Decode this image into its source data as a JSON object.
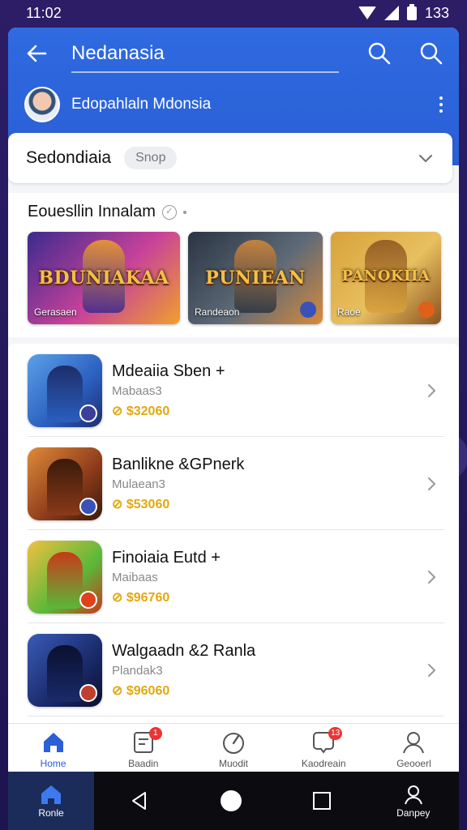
{
  "status_bar": {
    "time": "11:02",
    "battery": "133"
  },
  "header": {
    "title": "Nedanasia",
    "profile_name": "Edopahlaln Mdonsia"
  },
  "section": {
    "title": "Sedondiaia",
    "chip": "Snop"
  },
  "featured": {
    "title": "Eouesllin Innalam",
    "banners": [
      {
        "title": "BDUNIAKAA",
        "subtitle": "Gerasaen",
        "colors": [
          "#3b2a8f",
          "#c8429a",
          "#f0a02a"
        ]
      },
      {
        "title": "PUNIEAN",
        "subtitle": "Randeaon",
        "colors": [
          "#2a3442",
          "#5e6a78",
          "#d88a3a"
        ]
      },
      {
        "title": "PANOKIIA",
        "subtitle": "Raoe",
        "colors": [
          "#d8a23a",
          "#e8c060",
          "#8a5220"
        ]
      }
    ]
  },
  "apps": [
    {
      "name": "Mdeaiia Sben +",
      "developer": "Mabaas3",
      "price": "$32060",
      "colors": [
        "#2b5fbf",
        "#5aa0e8",
        "#1d2e6a"
      ],
      "accent": "#3a3f9a"
    },
    {
      "name": "Banlikne &GPnerk",
      "developer": "Mulaean3",
      "price": "$53060",
      "colors": [
        "#8a3a1a",
        "#e08a3a",
        "#3a1a0a"
      ],
      "accent": "#3a52b8"
    },
    {
      "name": "Finoiaia Eutd +",
      "developer": "Maibaas",
      "price": "$96760",
      "colors": [
        "#5ab83a",
        "#f0c040",
        "#c83a1a"
      ],
      "accent": "#e0401a"
    },
    {
      "name": "Walgaadn &2 Ranla",
      "developer": "Plandak3",
      "price": "$96060",
      "colors": [
        "#1a2a6a",
        "#3a5ab8",
        "#0a1030"
      ],
      "accent": "#c04030"
    }
  ],
  "tabs": [
    {
      "label": "Home",
      "icon": "home-icon",
      "badge": ""
    },
    {
      "label": "Baadin",
      "icon": "inbox-icon",
      "badge": "1"
    },
    {
      "label": "Muodit",
      "icon": "gauge-icon",
      "badge": ""
    },
    {
      "label": "Kaodreain",
      "icon": "chat-heart-icon",
      "badge": "13"
    },
    {
      "label": "Geooerl",
      "icon": "person-icon",
      "badge": ""
    }
  ],
  "system_nav": {
    "home_label": "Ronle",
    "account_label": "Danpey"
  },
  "colors": {
    "primary": "#2a5fd6",
    "price": "#e3a80f",
    "badge": "#e33333"
  }
}
